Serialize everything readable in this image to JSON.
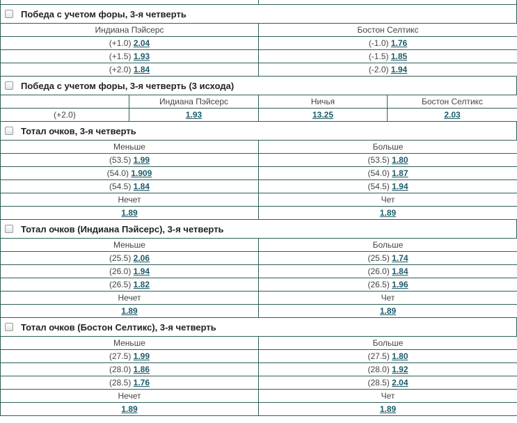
{
  "sections": [
    {
      "title": "Победа с учетом форы, 3-я четверть",
      "headers": [
        "Индиана Пэйсерс",
        "Бостон Селтикс"
      ],
      "rows": [
        {
          "l_hc": "(+1.0)",
          "l_odd": "2.04",
          "r_hc": "(-1.0)",
          "r_odd": "1.76"
        },
        {
          "l_hc": "(+1.5)",
          "l_odd": "1.93",
          "r_hc": "(-1.5)",
          "r_odd": "1.85"
        },
        {
          "l_hc": "(+2.0)",
          "l_odd": "1.84",
          "r_hc": "(-2.0)",
          "r_odd": "1.94"
        }
      ]
    },
    {
      "title": "Победа с учетом форы, 3-я четверть (3 исхода)",
      "headers": [
        "Индиана Пэйсерс",
        "Ничья",
        "Бостон Селтикс"
      ],
      "row": {
        "hc": "(+2.0)",
        "odds": [
          "1.93",
          "13.25",
          "2.03"
        ]
      }
    },
    {
      "title": "Тотал очков, 3-я четверть",
      "headers": [
        "Меньше",
        "Больше"
      ],
      "rows": [
        {
          "l_hc": "(53.5)",
          "l_odd": "1.99",
          "r_hc": "(53.5)",
          "r_odd": "1.80"
        },
        {
          "l_hc": "(54.0)",
          "l_odd": "1.909",
          "r_hc": "(54.0)",
          "r_odd": "1.87"
        },
        {
          "l_hc": "(54.5)",
          "l_odd": "1.84",
          "r_hc": "(54.5)",
          "r_odd": "1.94"
        }
      ],
      "parity_headers": [
        "Нечет",
        "Чет"
      ],
      "parity_odds": [
        "1.89",
        "1.89"
      ]
    },
    {
      "title": "Тотал очков (Индиана Пэйсерс), 3-я четверть",
      "headers": [
        "Меньше",
        "Больше"
      ],
      "rows": [
        {
          "l_hc": "(25.5)",
          "l_odd": "2.06",
          "r_hc": "(25.5)",
          "r_odd": "1.74"
        },
        {
          "l_hc": "(26.0)",
          "l_odd": "1.94",
          "r_hc": "(26.0)",
          "r_odd": "1.84"
        },
        {
          "l_hc": "(26.5)",
          "l_odd": "1.82",
          "r_hc": "(26.5)",
          "r_odd": "1.96"
        }
      ],
      "parity_headers": [
        "Нечет",
        "Чет"
      ],
      "parity_odds": [
        "1.89",
        "1.89"
      ]
    },
    {
      "title": "Тотал очков (Бостон Селтикс), 3-я четверть",
      "headers": [
        "Меньше",
        "Больше"
      ],
      "rows": [
        {
          "l_hc": "(27.5)",
          "l_odd": "1.99",
          "r_hc": "(27.5)",
          "r_odd": "1.80"
        },
        {
          "l_hc": "(28.0)",
          "l_odd": "1.86",
          "r_hc": "(28.0)",
          "r_odd": "1.92"
        },
        {
          "l_hc": "(28.5)",
          "l_odd": "1.76",
          "r_hc": "(28.5)",
          "r_odd": "2.04"
        }
      ],
      "parity_headers": [
        "Нечет",
        "Чет"
      ],
      "parity_odds": [
        "1.89",
        "1.89"
      ]
    }
  ]
}
